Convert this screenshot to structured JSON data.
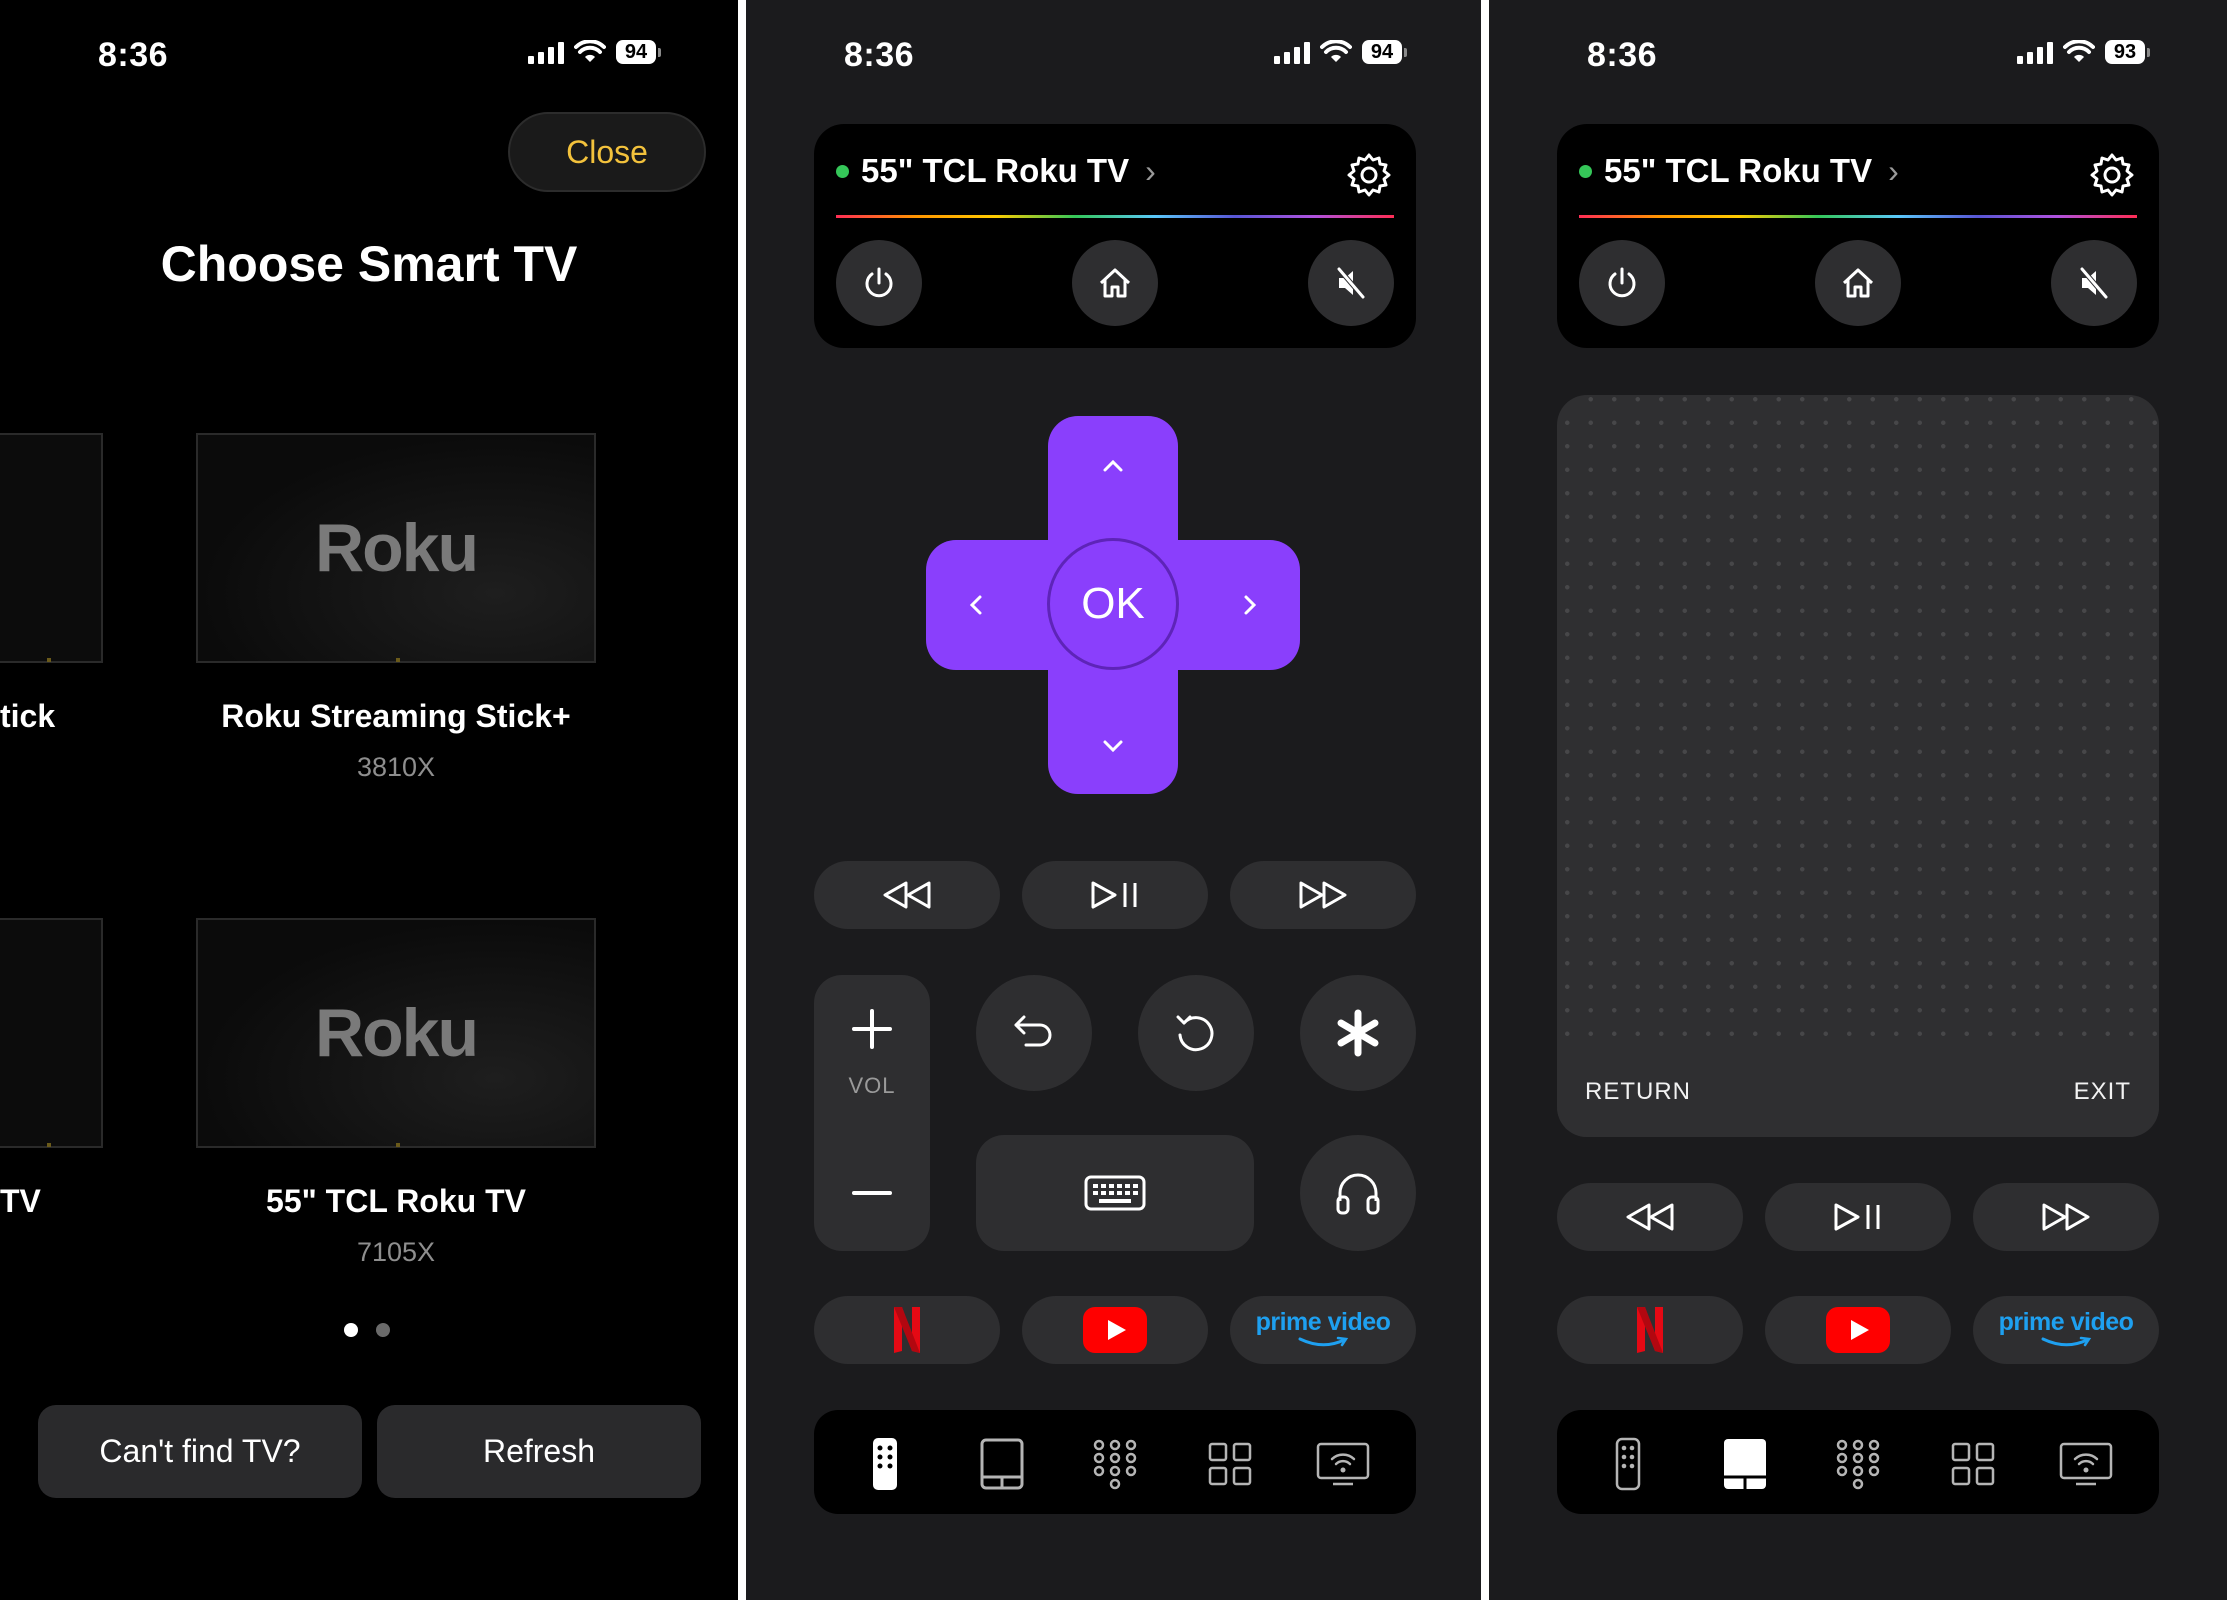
{
  "status_bar": [
    {
      "time": "8:36",
      "battery": "94"
    },
    {
      "time": "8:36",
      "battery": "94"
    },
    {
      "time": "8:36",
      "battery": "93"
    }
  ],
  "chooser": {
    "close_label": "Close",
    "title": "Choose Smart TV",
    "partial_labels": [
      "tick",
      "TV"
    ],
    "devices": [
      {
        "logo": "Roku",
        "name": "Roku Streaming Stick+",
        "model": "3810X"
      },
      {
        "logo": "Roku",
        "name": "55\" TCL Roku TV",
        "model": "7105X"
      }
    ],
    "page_dots": {
      "count": 2,
      "active": 1
    },
    "cant_find_label": "Can't find TV?",
    "refresh_label": "Refresh"
  },
  "remote": {
    "device_name": "55\" TCL Roku TV",
    "connected_color": "#35c759",
    "accent_color": "#8a3ffc",
    "ok_label": "OK",
    "vol_label": "VOL",
    "apps": [
      "netflix-logo",
      "youtube-logo",
      "prime-video-logo"
    ],
    "prime_label": "prime video",
    "nav_items": [
      "remote-icon",
      "touchpad-icon",
      "numpad-icon",
      "apps-grid-icon",
      "screen-cast-icon"
    ]
  },
  "touchpad": {
    "return_label": "RETURN",
    "exit_label": "EXIT"
  }
}
